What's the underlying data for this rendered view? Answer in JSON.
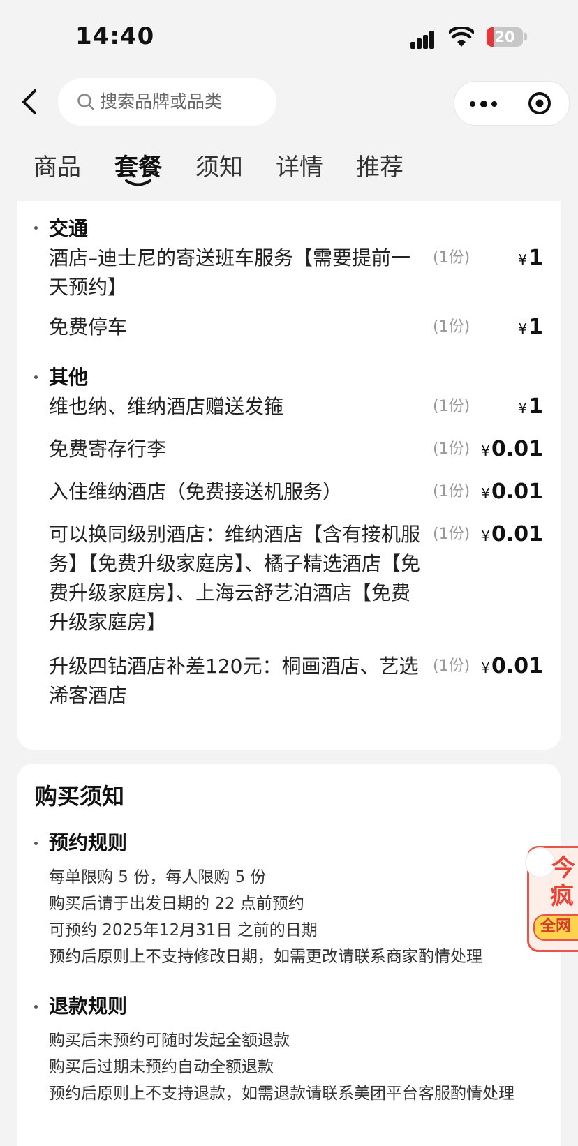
{
  "status_bar": {
    "time": "14:40",
    "battery": "20"
  },
  "search": {
    "placeholder": "搜索品牌或品类"
  },
  "tabs": [
    {
      "label": "商品"
    },
    {
      "label": "套餐"
    },
    {
      "label": "须知"
    },
    {
      "label": "详情"
    },
    {
      "label": "推荐"
    }
  ],
  "package": {
    "sections": [
      {
        "title": "交通",
        "items": [
          {
            "name": "酒店–迪士尼的寄送班车服务【需要提前一天预约】",
            "qty": "(1份)",
            "currency": "¥",
            "price": "1"
          },
          {
            "name": "免费停车",
            "qty": "(1份)",
            "currency": "¥",
            "price": "1"
          }
        ]
      },
      {
        "title": "其他",
        "items": [
          {
            "name": "维也纳、维纳酒店赠送发箍",
            "qty": "(1份)",
            "currency": "¥",
            "price": "1"
          },
          {
            "name": "免费寄存行李",
            "qty": "(1份)",
            "currency": "¥",
            "price": "0.01"
          },
          {
            "name": "入住维纳酒店（免费接送机服务）",
            "qty": "(1份)",
            "currency": "¥",
            "price": "0.01"
          },
          {
            "name": "可以换同级别酒店：维纳酒店【含有接机服务】【免费升级家庭房】、橘子精选酒店【免费升级家庭房】、上海云舒艺泊酒店【免费升级家庭房】",
            "qty": "(1份)",
            "currency": "¥",
            "price": "0.01"
          },
          {
            "name": "升级四钻酒店补差120元：桐画酒店、艺选浠客酒店",
            "qty": "(1份)",
            "currency": "¥",
            "price": "0.01"
          }
        ]
      }
    ]
  },
  "notice": {
    "title": "购买须知",
    "sections": [
      {
        "title": "预约规则",
        "lines": [
          "每单限购 5 份，每人限购 5 份",
          "购买后请于出发日期的 22 点前预约",
          "可预约 2025年12月31日 之前的日期",
          "预约后原则上不支持修改日期，如需更改请联系商家酌情处理"
        ]
      },
      {
        "title": "退款规则",
        "lines": [
          "购买后未预约可随时发起全额退款",
          "购买后过期未预约自动全额退款",
          "预约后原则上不支持退款，如需退款请联系美团平台客服酌情处理"
        ]
      }
    ]
  },
  "float_ad": {
    "line1": "今",
    "line2": "疯",
    "line3": "全网",
    "accent": "#e8453a"
  },
  "colors": {
    "background": "#f3f3f3",
    "card": "#ffffff",
    "battery_low": "#e8353a"
  }
}
